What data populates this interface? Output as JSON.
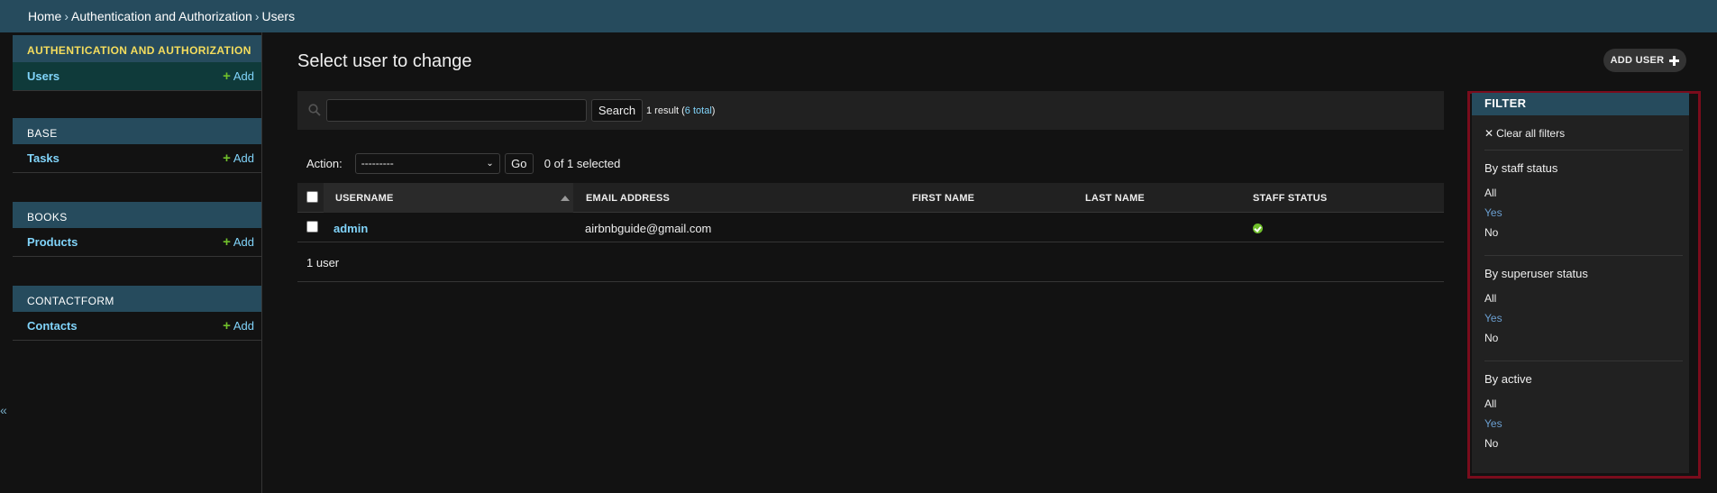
{
  "breadcrumbs": {
    "home": "Home",
    "section": "Authentication and Authorization",
    "current": "Users",
    "separator": "›"
  },
  "sidebar": {
    "collapse_glyph": "«",
    "add_label": "Add",
    "add_glyph": "+",
    "modules": [
      {
        "header": "AUTHENTICATION AND AUTHORIZATION",
        "model": "Users"
      },
      {
        "header": "BASE",
        "model": "Tasks"
      },
      {
        "header": "BOOKS",
        "model": "Products"
      },
      {
        "header": "CONTACTFORM",
        "model": "Contacts"
      }
    ]
  },
  "main": {
    "title": "Select user to change",
    "add_button": "ADD USER",
    "search": {
      "value": "",
      "placeholder": "",
      "button": "Search",
      "result_prefix": "1 result (",
      "result_total": "6 total",
      "result_suffix": ")"
    },
    "actions": {
      "label": "Action:",
      "selected_option": "---------",
      "go": "Go",
      "selected_count": "0 of 1 selected"
    },
    "table": {
      "columns": [
        "USERNAME",
        "EMAIL ADDRESS",
        "FIRST NAME",
        "LAST NAME",
        "STAFF STATUS"
      ],
      "rows": [
        {
          "username": "admin",
          "email": "airbnbguide@gmail.com",
          "first_name": "",
          "last_name": "",
          "staff_status": "true"
        }
      ],
      "footer": "1 user"
    }
  },
  "filter": {
    "header": "FILTER",
    "clear": "Clear all filters",
    "groups": [
      {
        "title": "By staff status",
        "options": [
          "All",
          "Yes",
          "No"
        ],
        "selected": "Yes"
      },
      {
        "title": "By superuser status",
        "options": [
          "All",
          "Yes",
          "No"
        ],
        "selected": "Yes"
      },
      {
        "title": "By active",
        "options": [
          "All",
          "Yes",
          "No"
        ],
        "selected": "Yes"
      }
    ]
  },
  "colors": {
    "header_bg": "#264b5d",
    "accent_link": "#81d4fa",
    "add_green": "#70bf2b",
    "highlight_outline": "#7a0c1c",
    "body_bg": "#121212"
  }
}
